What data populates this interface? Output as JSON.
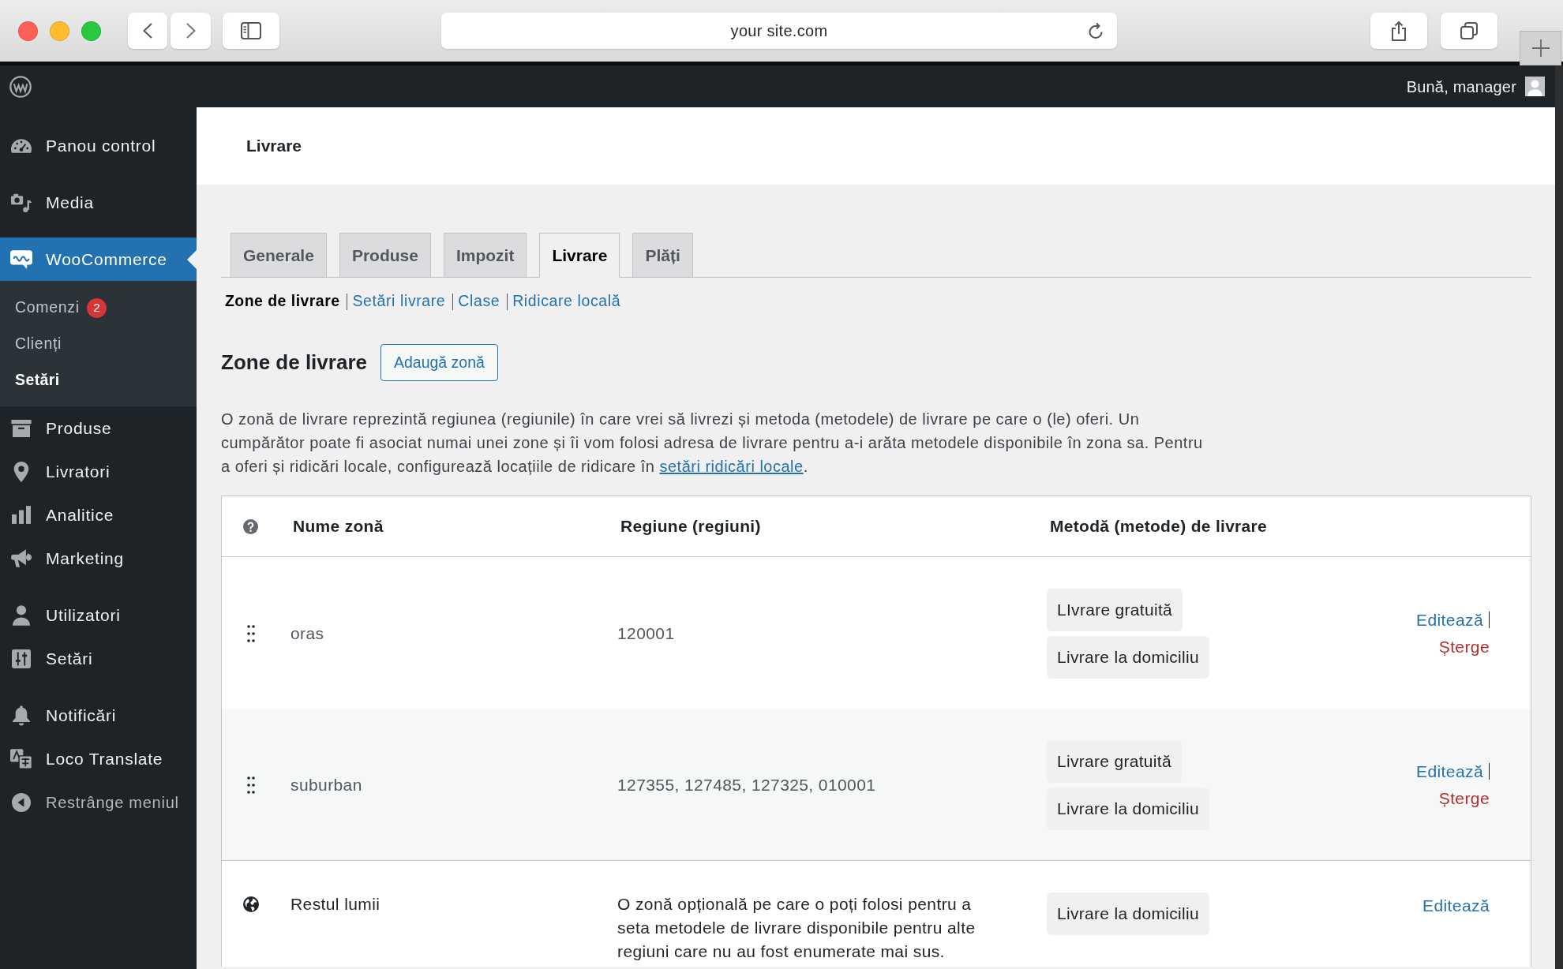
{
  "browser": {
    "url": "your site.com"
  },
  "admin_bar": {
    "greeting": "Bună, manager"
  },
  "sidebar": {
    "groups": [
      [
        {
          "label": "Panou control",
          "selected": false
        }
      ],
      [
        {
          "label": "Media",
          "selected": false
        }
      ],
      [
        {
          "label": "WooCommerce",
          "selected": true,
          "submenu": [
            {
              "label": "Comenzi",
              "badge": "2",
              "selected": false
            },
            {
              "label": "Clienți",
              "selected": false
            },
            {
              "label": "Setări",
              "selected": true
            }
          ]
        },
        {
          "label": "Produse",
          "selected": false
        },
        {
          "label": "Livratori",
          "selected": false
        },
        {
          "label": "Analitice",
          "selected": false
        },
        {
          "label": "Marketing",
          "selected": false
        }
      ],
      [
        {
          "label": "Utilizatori",
          "selected": false
        },
        {
          "label": "Setări",
          "selected": false
        }
      ],
      [
        {
          "label": "Notificări",
          "selected": false
        },
        {
          "label": "Loco Translate",
          "selected": false
        }
      ]
    ],
    "collapse_label": "Restrânge meniul"
  },
  "page": {
    "title": "Livrare"
  },
  "tabs": [
    {
      "label": "Generale",
      "selected": false
    },
    {
      "label": "Produse",
      "selected": false
    },
    {
      "label": "Impozit",
      "selected": false
    },
    {
      "label": "Livrare",
      "selected": true
    },
    {
      "label": "Plăți",
      "selected": false
    }
  ],
  "subnav": [
    {
      "label": "Zone de livrare",
      "selected": true
    },
    {
      "label": "Setări livrare",
      "selected": false
    },
    {
      "label": "Clase",
      "selected": false
    },
    {
      "label": "Ridicare locală",
      "selected": false
    }
  ],
  "section": {
    "heading": "Zone de livrare",
    "add_button": "Adaugă zonă",
    "description": {
      "text": "O zonă de livrare reprezintă regiunea (regiunile) în care vrei să livrezi și metoda (metodele) de livrare pe care o (le) oferi. Un cumpărător poate fi asociat numai unei zone și îi vom folosi adresa de livrare pentru a-i arăta metodele disponibile în zona sa. Pentru a oferi și ridicări locale, configurează locațiile de ridicare în ",
      "link": "setări ridicări locale",
      "after": "."
    }
  },
  "zones_table": {
    "columns": [
      {
        "label": "Nume zonă"
      },
      {
        "label": "Regiune (regiuni)"
      },
      {
        "label": "Metodă (metode) de livrare"
      }
    ],
    "rows": [
      {
        "kind": "zone",
        "name": "oras",
        "regions": "120001",
        "methods": [
          "LIvrare gratuită",
          "Livrare la domiciliu"
        ],
        "actions": [
          {
            "kind": "edit",
            "label": "Editează"
          },
          {
            "kind": "delete",
            "label": "Șterge"
          }
        ]
      },
      {
        "kind": "zone",
        "name": "suburban",
        "regions": "127355, 127485, 127325, 010001",
        "methods": [
          "Livrare gratuită",
          "Livrare la domiciliu"
        ],
        "actions": [
          {
            "kind": "edit",
            "label": "Editează"
          },
          {
            "kind": "delete",
            "label": "Șterge"
          }
        ]
      },
      {
        "kind": "rest_of_world",
        "name": "Restul lumii",
        "regions": "O zonă opțională pe care o poți folosi pentru a seta metodele de livrare disponibile pentru alte regiuni care nu au fost enumerate mai sus.",
        "methods": [
          "Livrare la domiciliu"
        ],
        "actions": [
          {
            "kind": "edit",
            "label": "Editează"
          }
        ]
      }
    ]
  }
}
